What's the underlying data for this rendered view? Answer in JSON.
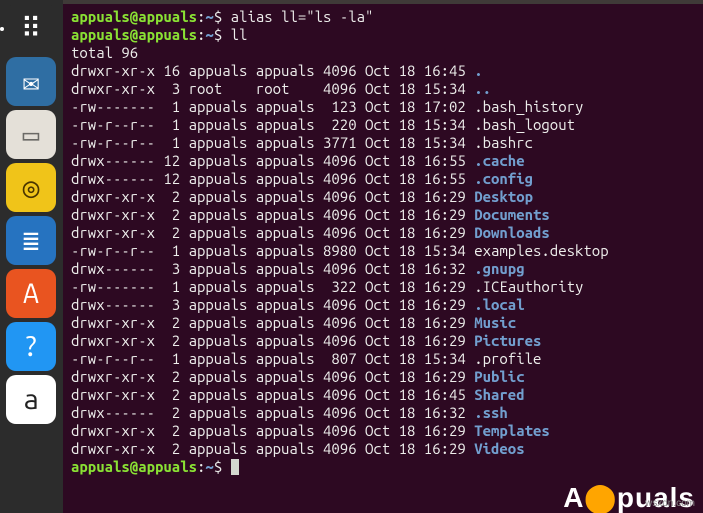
{
  "prompt": {
    "user": "appuals@appuals",
    "sep": ":",
    "cwd": "~",
    "sigil": "$"
  },
  "commands": {
    "alias": "alias ll=\"ls -la\"",
    "ll": "ll"
  },
  "listing_header": "total 96",
  "files": [
    {
      "perm": "drwxr-xr-x",
      "links": "16",
      "owner": "appuals",
      "group": "appuals",
      "size": "4096",
      "date": "Oct 18 16:45",
      "name": ".",
      "color": "blue"
    },
    {
      "perm": "drwxr-xr-x",
      "links": " 3",
      "owner": "root   ",
      "group": "root   ",
      "size": "4096",
      "date": "Oct 18 15:34",
      "name": "..",
      "color": "blue"
    },
    {
      "perm": "-rw-------",
      "links": " 1",
      "owner": "appuals",
      "group": "appuals",
      "size": " 123",
      "date": "Oct 18 17:02",
      "name": ".bash_history",
      "color": "white"
    },
    {
      "perm": "-rw-r--r--",
      "links": " 1",
      "owner": "appuals",
      "group": "appuals",
      "size": " 220",
      "date": "Oct 18 15:34",
      "name": ".bash_logout",
      "color": "white"
    },
    {
      "perm": "-rw-r--r--",
      "links": " 1",
      "owner": "appuals",
      "group": "appuals",
      "size": "3771",
      "date": "Oct 18 15:34",
      "name": ".bashrc",
      "color": "white"
    },
    {
      "perm": "drwx------",
      "links": "12",
      "owner": "appuals",
      "group": "appuals",
      "size": "4096",
      "date": "Oct 18 16:55",
      "name": ".cache",
      "color": "blue"
    },
    {
      "perm": "drwx------",
      "links": "12",
      "owner": "appuals",
      "group": "appuals",
      "size": "4096",
      "date": "Oct 18 16:55",
      "name": ".config",
      "color": "blue"
    },
    {
      "perm": "drwxr-xr-x",
      "links": " 2",
      "owner": "appuals",
      "group": "appuals",
      "size": "4096",
      "date": "Oct 18 16:29",
      "name": "Desktop",
      "color": "blue"
    },
    {
      "perm": "drwxr-xr-x",
      "links": " 2",
      "owner": "appuals",
      "group": "appuals",
      "size": "4096",
      "date": "Oct 18 16:29",
      "name": "Documents",
      "color": "blue"
    },
    {
      "perm": "drwxr-xr-x",
      "links": " 2",
      "owner": "appuals",
      "group": "appuals",
      "size": "4096",
      "date": "Oct 18 16:29",
      "name": "Downloads",
      "color": "blue"
    },
    {
      "perm": "-rw-r--r--",
      "links": " 1",
      "owner": "appuals",
      "group": "appuals",
      "size": "8980",
      "date": "Oct 18 15:34",
      "name": "examples.desktop",
      "color": "white"
    },
    {
      "perm": "drwx------",
      "links": " 3",
      "owner": "appuals",
      "group": "appuals",
      "size": "4096",
      "date": "Oct 18 16:32",
      "name": ".gnupg",
      "color": "blue"
    },
    {
      "perm": "-rw-------",
      "links": " 1",
      "owner": "appuals",
      "group": "appuals",
      "size": " 322",
      "date": "Oct 18 16:29",
      "name": ".ICEauthority",
      "color": "white"
    },
    {
      "perm": "drwx------",
      "links": " 3",
      "owner": "appuals",
      "group": "appuals",
      "size": "4096",
      "date": "Oct 18 16:29",
      "name": ".local",
      "color": "blue"
    },
    {
      "perm": "drwxr-xr-x",
      "links": " 2",
      "owner": "appuals",
      "group": "appuals",
      "size": "4096",
      "date": "Oct 18 16:29",
      "name": "Music",
      "color": "blue"
    },
    {
      "perm": "drwxr-xr-x",
      "links": " 2",
      "owner": "appuals",
      "group": "appuals",
      "size": "4096",
      "date": "Oct 18 16:29",
      "name": "Pictures",
      "color": "blue"
    },
    {
      "perm": "-rw-r--r--",
      "links": " 1",
      "owner": "appuals",
      "group": "appuals",
      "size": " 807",
      "date": "Oct 18 15:34",
      "name": ".profile",
      "color": "white"
    },
    {
      "perm": "drwxr-xr-x",
      "links": " 2",
      "owner": "appuals",
      "group": "appuals",
      "size": "4096",
      "date": "Oct 18 16:29",
      "name": "Public",
      "color": "blue"
    },
    {
      "perm": "drwxr-xr-x",
      "links": " 2",
      "owner": "appuals",
      "group": "appuals",
      "size": "4096",
      "date": "Oct 18 16:45",
      "name": "Shared",
      "color": "blue"
    },
    {
      "perm": "drwx------",
      "links": " 2",
      "owner": "appuals",
      "group": "appuals",
      "size": "4096",
      "date": "Oct 18 16:32",
      "name": ".ssh",
      "color": "blue"
    },
    {
      "perm": "drwxr-xr-x",
      "links": " 2",
      "owner": "appuals",
      "group": "appuals",
      "size": "4096",
      "date": "Oct 18 16:29",
      "name": "Templates",
      "color": "blue"
    },
    {
      "perm": "drwxr-xr-x",
      "links": " 2",
      "owner": "appuals",
      "group": "appuals",
      "size": "4096",
      "date": "Oct 18 16:29",
      "name": "Videos",
      "color": "blue"
    }
  ],
  "launcher": [
    {
      "name": "show-apps-icon",
      "glyph": "⠿",
      "bg": "#2c2c2c",
      "fg": "#ffffff"
    },
    {
      "name": "thunderbird-icon",
      "glyph": "✉",
      "bg": "#2f6ea3",
      "fg": "#ffffff"
    },
    {
      "name": "files-icon",
      "glyph": "▭",
      "bg": "#e4e0d8",
      "fg": "#6b6a66"
    },
    {
      "name": "rhythmbox-icon",
      "glyph": "◎",
      "bg": "#f0c419",
      "fg": "#4a3500"
    },
    {
      "name": "libreoffice-icon",
      "glyph": "≣",
      "bg": "#2673c0",
      "fg": "#ffffff"
    },
    {
      "name": "software-icon",
      "glyph": "A",
      "bg": "#e95420",
      "fg": "#ffffff"
    },
    {
      "name": "help-icon",
      "glyph": "?",
      "bg": "#2196f3",
      "fg": "#ffffff"
    },
    {
      "name": "amazon-icon",
      "glyph": "a",
      "bg": "#ffffff",
      "fg": "#222222"
    }
  ],
  "watermark": {
    "text_a": "A",
    "text_b": "puals",
    "sub": "wsxdn.com"
  }
}
